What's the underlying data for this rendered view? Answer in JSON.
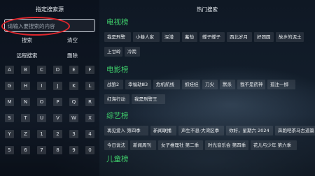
{
  "left_panel": {
    "title": "指定搜索源",
    "search": {
      "placeholder": "请输入要搜索的内容"
    },
    "buttons_row1": [
      "搜索",
      "清空"
    ],
    "buttons_row2": [
      "远程搜索",
      "删除"
    ],
    "keys": [
      "A",
      "B",
      "C",
      "D",
      "E",
      "F",
      "G",
      "H",
      "I",
      "J",
      "K",
      "L",
      "M",
      "N",
      "O",
      "P",
      "Q",
      "R",
      "S",
      "T",
      "U",
      "V",
      "W",
      "X",
      "Y",
      "Z",
      "1",
      "2",
      "3",
      "4",
      "5",
      "6",
      "7",
      "8",
      "9",
      "0"
    ]
  },
  "hot_search": {
    "title": "热门搜索",
    "sections": [
      {
        "title": "电视榜",
        "rows": [
          [
            "我是刑警",
            "小巷人家",
            "深潜",
            "蓄劫",
            "蝶子蝶子",
            "西北岁月",
            "好团圆",
            "故乡的泥土"
          ],
          [
            "上甘岭",
            "冷箭"
          ]
        ]
      },
      {
        "title": "电影榜",
        "rows": [
          [
            "战狼2",
            "幸福劫Ⅲ3",
            "危机航线",
            "抓娃娃",
            "刀尖",
            "默杀",
            "我不是药神",
            "孤注一掷"
          ],
          [
            "红海行动",
            "我是刑警王"
          ]
        ]
      },
      {
        "title": "综艺榜",
        "rows": [
          [
            "再见爱人 第四季",
            "新闻联播",
            "声生不息·大湾区季",
            "你好，星期六 2024",
            "奔跑吧茶马古道篇"
          ],
          [
            "今日说法",
            "新闻周刊",
            "女子推理社 第二季",
            "时光音乐会 第四季",
            "花儿与少年 第六季"
          ]
        ]
      },
      {
        "title": "儿童榜",
        "rows": []
      }
    ]
  },
  "colors": {
    "section_title": "#3fce6b",
    "highlight_oval": "#e0262c"
  }
}
